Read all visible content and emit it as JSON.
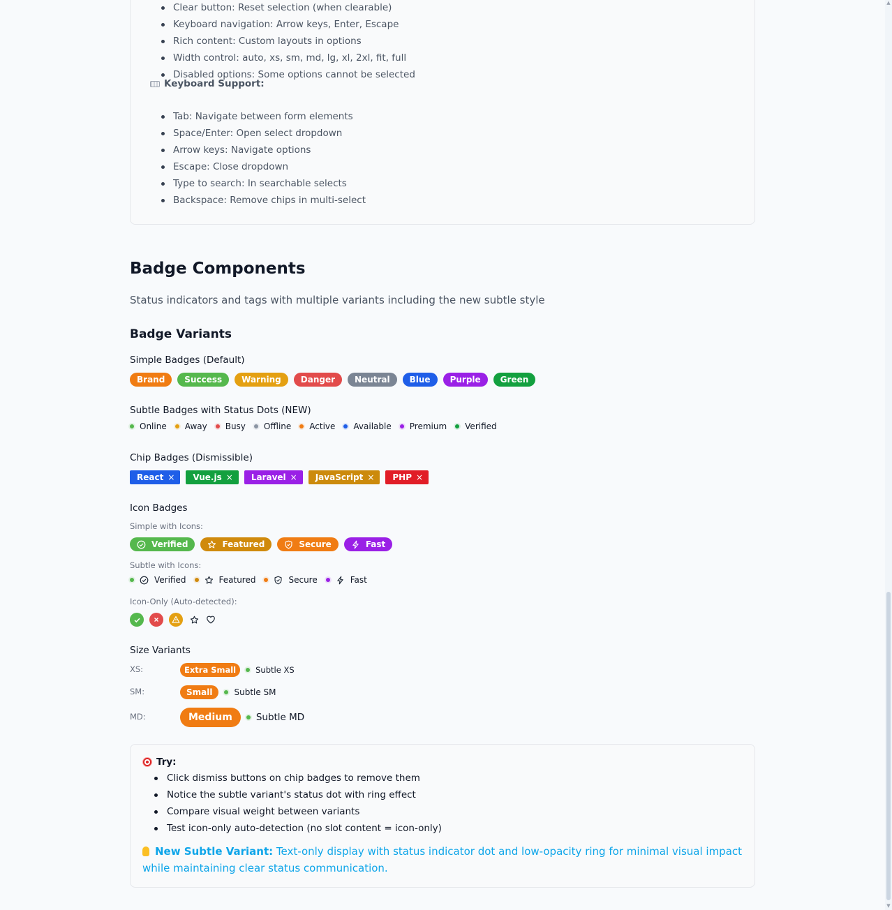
{
  "features_list": [
    "Clear button: Reset selection (when clearable)",
    "Keyboard navigation: Arrow keys, Enter, Escape",
    "Rich content: Custom layouts in options",
    "Width control: auto, xs, sm, md, lg, xl, 2xl, fit, full",
    "Disabled options: Some options cannot be selected"
  ],
  "keyboard": {
    "heading": "Keyboard Support:",
    "items": [
      "Tab: Navigate between form elements",
      "Space/Enter: Open select dropdown",
      "Arrow keys: Navigate options",
      "Escape: Close dropdown",
      "Type to search: In searchable selects",
      "Backspace: Remove chips in multi-select"
    ]
  },
  "section": {
    "title": "Badge Components",
    "subtitle": "Status indicators and tags with multiple variants including the new subtle style",
    "variants_title": "Badge Variants"
  },
  "simple": {
    "label": "Simple Badges (Default)",
    "badges": [
      {
        "text": "Brand",
        "color": "#f07c13"
      },
      {
        "text": "Success",
        "color": "#55b84d"
      },
      {
        "text": "Warning",
        "color": "#e4a012"
      },
      {
        "text": "Danger",
        "color": "#e24b4b"
      },
      {
        "text": "Neutral",
        "color": "#7b8594"
      },
      {
        "text": "Blue",
        "color": "#1f5ee8"
      },
      {
        "text": "Purple",
        "color": "#9a20e6"
      },
      {
        "text": "Green",
        "color": "#13a03f"
      }
    ]
  },
  "subtle": {
    "label": "Subtle Badges with Status Dots (NEW)",
    "badges": [
      {
        "text": "Online",
        "color": "#55b84d"
      },
      {
        "text": "Away",
        "color": "#e4a012"
      },
      {
        "text": "Busy",
        "color": "#e24b4b"
      },
      {
        "text": "Offline",
        "color": "#8b95a3"
      },
      {
        "text": "Active",
        "color": "#f07c13"
      },
      {
        "text": "Available",
        "color": "#1f5ee8"
      },
      {
        "text": "Premium",
        "color": "#9a20e6"
      },
      {
        "text": "Verified",
        "color": "#13a03f"
      }
    ]
  },
  "chips": {
    "label": "Chip Badges (Dismissible)",
    "items": [
      {
        "text": "React",
        "color": "#1f5ee8"
      },
      {
        "text": "Vue.js",
        "color": "#13a03f"
      },
      {
        "text": "Laravel",
        "color": "#9a20e6"
      },
      {
        "text": "JavaScript",
        "color": "#cc8a0c"
      },
      {
        "text": "PHP",
        "color": "#e11d27"
      }
    ],
    "dismiss_glyph": "×"
  },
  "icon_badges": {
    "label": "Icon Badges",
    "simple_label": "Simple with Icons:",
    "simple": [
      {
        "text": "Verified",
        "color": "#55b84d",
        "icon": "check-circle-icon"
      },
      {
        "text": "Featured",
        "color": "#d08a0c",
        "icon": "star-icon"
      },
      {
        "text": "Secure",
        "color": "#f07c13",
        "icon": "shield-check-icon"
      },
      {
        "text": "Fast",
        "color": "#9a20e6",
        "icon": "bolt-icon"
      }
    ],
    "subtle_label": "Subtle with Icons:",
    "subtle": [
      {
        "text": "Verified",
        "color": "#55b84d",
        "icon": "check-circle-icon"
      },
      {
        "text": "Featured",
        "color": "#d08a0c",
        "icon": "star-icon"
      },
      {
        "text": "Secure",
        "color": "#f07c13",
        "icon": "shield-check-icon"
      },
      {
        "text": "Fast",
        "color": "#9a20e6",
        "icon": "bolt-icon"
      }
    ],
    "icon_only_label": "Icon-Only (Auto-detected):",
    "icon_only": [
      {
        "icon": "check-icon",
        "color": "#55b84d"
      },
      {
        "icon": "x-icon",
        "color": "#e24b4b"
      },
      {
        "icon": "warning-icon",
        "color": "#e4a012"
      },
      {
        "icon": "star-icon",
        "color": ""
      },
      {
        "icon": "heart-icon",
        "color": ""
      }
    ]
  },
  "sizes": {
    "label": "Size Variants",
    "rows": [
      {
        "label": "XS:",
        "pill": "Extra Small",
        "subtle": "Subtle XS"
      },
      {
        "label": "SM:",
        "pill": "Small",
        "subtle": "Subtle SM"
      },
      {
        "label": "MD:",
        "pill": "Medium",
        "subtle": "Subtle MD"
      }
    ],
    "pill_color": "#f07c13",
    "dot_color": "#55b84d"
  },
  "try": {
    "heading": "Try:",
    "items": [
      "Click dismiss buttons on chip badges to remove them",
      "Notice the subtle variant's status dot with ring effect",
      "Compare visual weight between variants",
      "Test icon-only auto-detection (no slot content = icon-only)"
    ],
    "note_bold": "New Subtle Variant:",
    "note_text": " Text-only display with status indicator dot and low-opacity ring for minimal visual impact while maintaining clear status communication."
  }
}
